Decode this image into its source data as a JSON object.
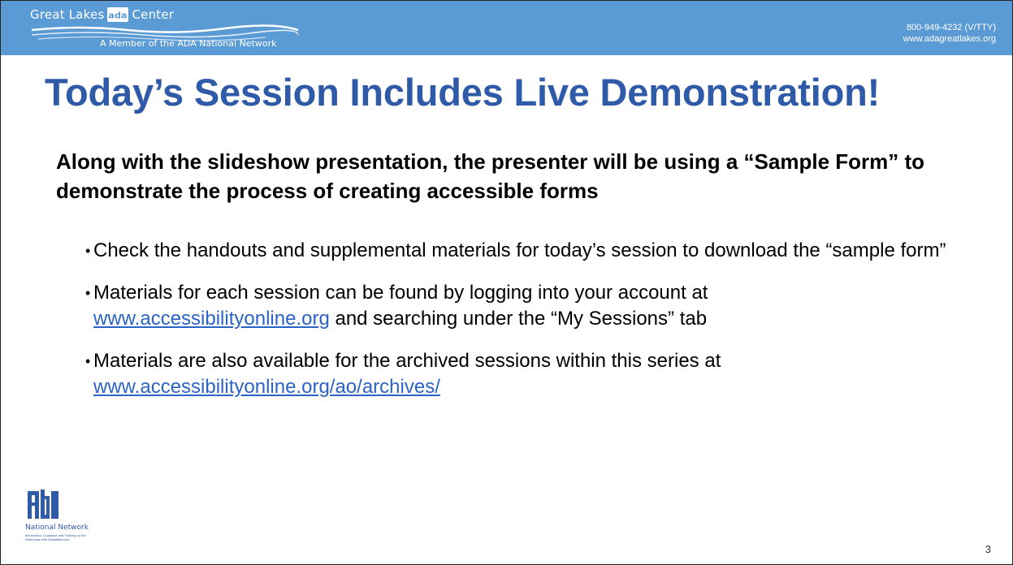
{
  "header": {
    "logo_text_1": "Great Lakes",
    "logo_text_2": "Center",
    "logo_ada": "ada",
    "logo_tagline": "A Member of the ADA National Network",
    "phone": "800-949-4232 (V/TTY)",
    "website": "www.adagreatlakes.org",
    "bar_color": "#5b9bd5"
  },
  "slide": {
    "title": "Today’s Session Includes Live Demonstration!",
    "title_color": "#2e5aa8",
    "intro": "Along with the slideshow presentation, the presenter will be using a “Sample Form” to demonstrate the process of creating accessible forms",
    "bullets": [
      {
        "text": "Check the handouts and supplemental materials for today’s session to download the “sample form”"
      },
      {
        "text_before": "Materials for each session can be found by logging into your account at",
        "link": "www.accessibilityonline.org",
        "text_after": "and searching under the “My Sessions” tab"
      },
      {
        "text": "Materials are also available for the archived sessions within this series at",
        "link": "www.accessibilityonline.org/ao/archives/"
      }
    ],
    "link_color": "#2b63c6",
    "bullet_symbol": "•"
  },
  "footer": {
    "logo_ada": "ada",
    "logo_label": "National Network",
    "logo_tag_1": "Information, Guidance and Training on the",
    "logo_tag_2": "Americans with Disabilities Act",
    "page_number": "3"
  }
}
